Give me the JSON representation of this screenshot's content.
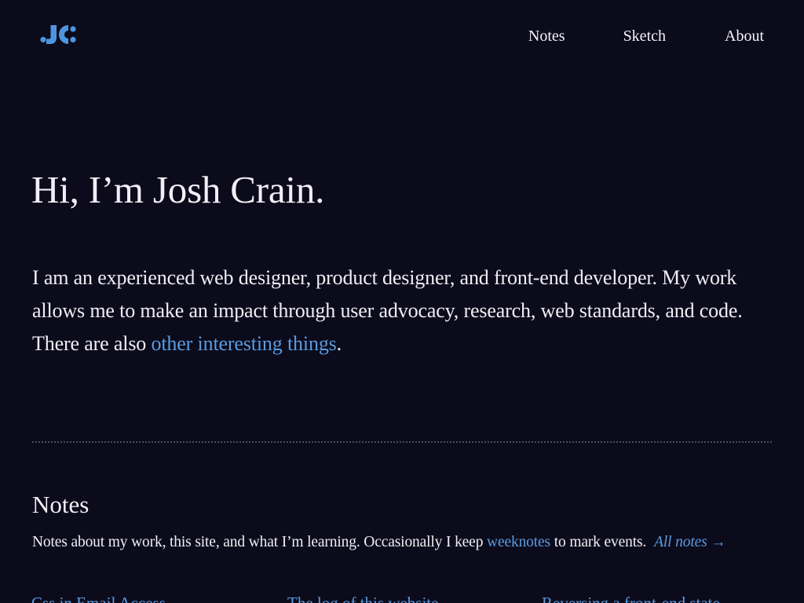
{
  "colors": {
    "background": "#0b0b1c",
    "text": "#f2f0f4",
    "accent": "#5b9bdf",
    "logo": "#4f95de"
  },
  "header": {
    "logo_icon": "jc-monogram-logo",
    "nav": [
      {
        "label": "Notes"
      },
      {
        "label": "Sketch"
      },
      {
        "label": "About"
      }
    ]
  },
  "hero": {
    "title": "Hi, I’m Josh Crain.",
    "intro_text": "I am an experienced web designer, product designer, and front-end developer. My work allows me to make an impact through user advocacy, research, web standards, and code. There are also ",
    "intro_link": "other interesting things",
    "intro_end": "."
  },
  "notes_section": {
    "title": "Notes",
    "description_before": "Notes about my work, this site, and what I’m learning. Occasionally I keep ",
    "weeknotes_link": "weeknotes",
    "description_after": " to mark events.",
    "all_notes_link": "All notes →",
    "items": [
      {
        "title": "Css in Email Access"
      },
      {
        "title": "The log of this website"
      },
      {
        "title": "Reversing a front-end state"
      }
    ]
  }
}
